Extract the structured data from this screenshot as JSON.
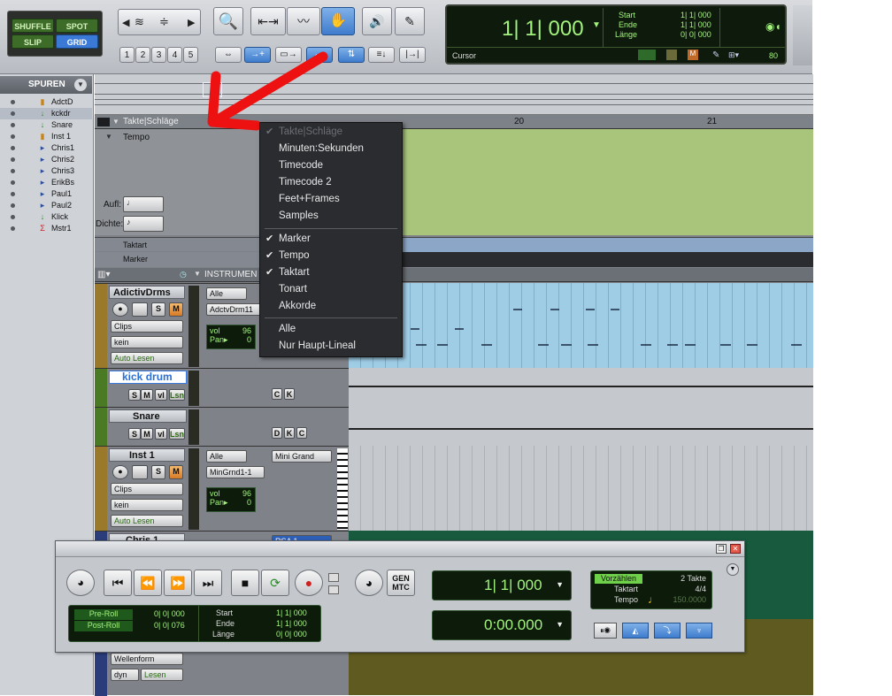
{
  "toolbar": {
    "edit_modes": [
      "SHUFFLE",
      "SPOT",
      "SLIP",
      "GRID"
    ],
    "grid_numbers": [
      "1",
      "2",
      "3",
      "4",
      "5"
    ]
  },
  "counter": {
    "main_value": "1| 1| 000",
    "start_label": "Start",
    "end_label": "Ende",
    "length_label": "Länge",
    "start_value": "1| 1| 000",
    "end_value": "1| 1| 000",
    "length_value": "0| 0| 000",
    "cursor_label": "Cursor",
    "nudge_value": "80"
  },
  "sidebar": {
    "title": "SPUREN",
    "tracks": [
      {
        "name": "AdctD",
        "icon": "instrument"
      },
      {
        "name": "kckdr",
        "icon": "audio"
      },
      {
        "name": "Snare",
        "icon": "audio"
      },
      {
        "name": "Inst 1",
        "icon": "instrument"
      },
      {
        "name": "Chris1",
        "icon": "midi"
      },
      {
        "name": "Chris2",
        "icon": "midi"
      },
      {
        "name": "Chris3",
        "icon": "midi"
      },
      {
        "name": "ErikBs",
        "icon": "midi"
      },
      {
        "name": "Paul1",
        "icon": "midi"
      },
      {
        "name": "Paul2",
        "icon": "midi"
      },
      {
        "name": "Klick",
        "icon": "audio"
      },
      {
        "name": "Mstr1",
        "icon": "master"
      }
    ]
  },
  "rulers": {
    "main_ruler": "Takte|Schläge",
    "tempo": "Tempo",
    "aufl": "Aufl:",
    "dichte": "Dichte:",
    "taktart": "Taktart",
    "marker": "Marker",
    "bar_20": "20",
    "bar_21": "21",
    "instrument_header": "INSTRUMEN"
  },
  "dropdown_menu": {
    "items": [
      {
        "label": "Takte|Schläge",
        "checked": true,
        "disabled": true
      },
      {
        "label": "Minuten:Sekunden",
        "checked": false
      },
      {
        "label": "Timecode",
        "checked": false
      },
      {
        "label": "Timecode 2",
        "checked": false
      },
      {
        "label": "Feet+Frames",
        "checked": false
      },
      {
        "label": "Samples",
        "checked": false
      },
      {
        "label": "Marker",
        "checked": true
      },
      {
        "label": "Tempo",
        "checked": true
      },
      {
        "label": "Taktart",
        "checked": true
      },
      {
        "label": "Tonart",
        "checked": false
      },
      {
        "label": "Akkorde",
        "checked": false
      },
      {
        "label": "Alle",
        "checked": false
      },
      {
        "label": "Nur Haupt-Lineal",
        "checked": false
      }
    ]
  },
  "tracks": {
    "adictiv": {
      "name": "AdictivDrms",
      "clips": "Clips",
      "kein": "kein",
      "auto": "Auto Lesen",
      "alle": "Alle",
      "device": "AdctvDrm11",
      "vol_label": "vol",
      "vol": "96",
      "pan_label": "Pan",
      "pan": "0"
    },
    "kick": {
      "name": "kick drum",
      "s": "S",
      "m": "M",
      "vl": "vl",
      "lsn": "Lsn",
      "c": "C",
      "k": "K"
    },
    "snare": {
      "name": "Snare",
      "s": "S",
      "m": "M",
      "vl": "vl",
      "lsn": "Lsn",
      "d": "D",
      "k": "K",
      "c": "C"
    },
    "inst1": {
      "name": "Inst 1",
      "clips": "Clips",
      "kein": "kein",
      "auto": "Auto Lesen",
      "alle": "Alle",
      "device": "MinGrnd1-1",
      "plugin": "Mini Grand",
      "vol_label": "vol",
      "vol": "96",
      "pan_label": "Pan",
      "pan": "0"
    },
    "chris1": {
      "name": "Chris 1",
      "insert": "RSA 1"
    },
    "bottom": {
      "wellenform": "Wellenform",
      "dyn": "dyn",
      "lesen": "Lesen"
    }
  },
  "transport": {
    "main_counter": "1| 1| 000",
    "sub_counter": "0:00.000",
    "preroll_label": "Pre-Roll",
    "postroll_label": "Post-Roll",
    "preroll_value": "0| 0| 000",
    "postroll_value": "0| 0| 076",
    "start_label": "Start",
    "end_label": "Ende",
    "length_label": "Länge",
    "start_value": "1| 1| 000",
    "end_value": "1| 1| 000",
    "length_value": "0| 0| 000",
    "gen_mtc": "GEN MTC",
    "count_off_label": "Vorzählen",
    "count_off_value": "2 Takte",
    "meter_label": "Taktart",
    "meter_value": "4/4",
    "tempo_label": "Tempo",
    "tempo_value": "150.0000"
  }
}
